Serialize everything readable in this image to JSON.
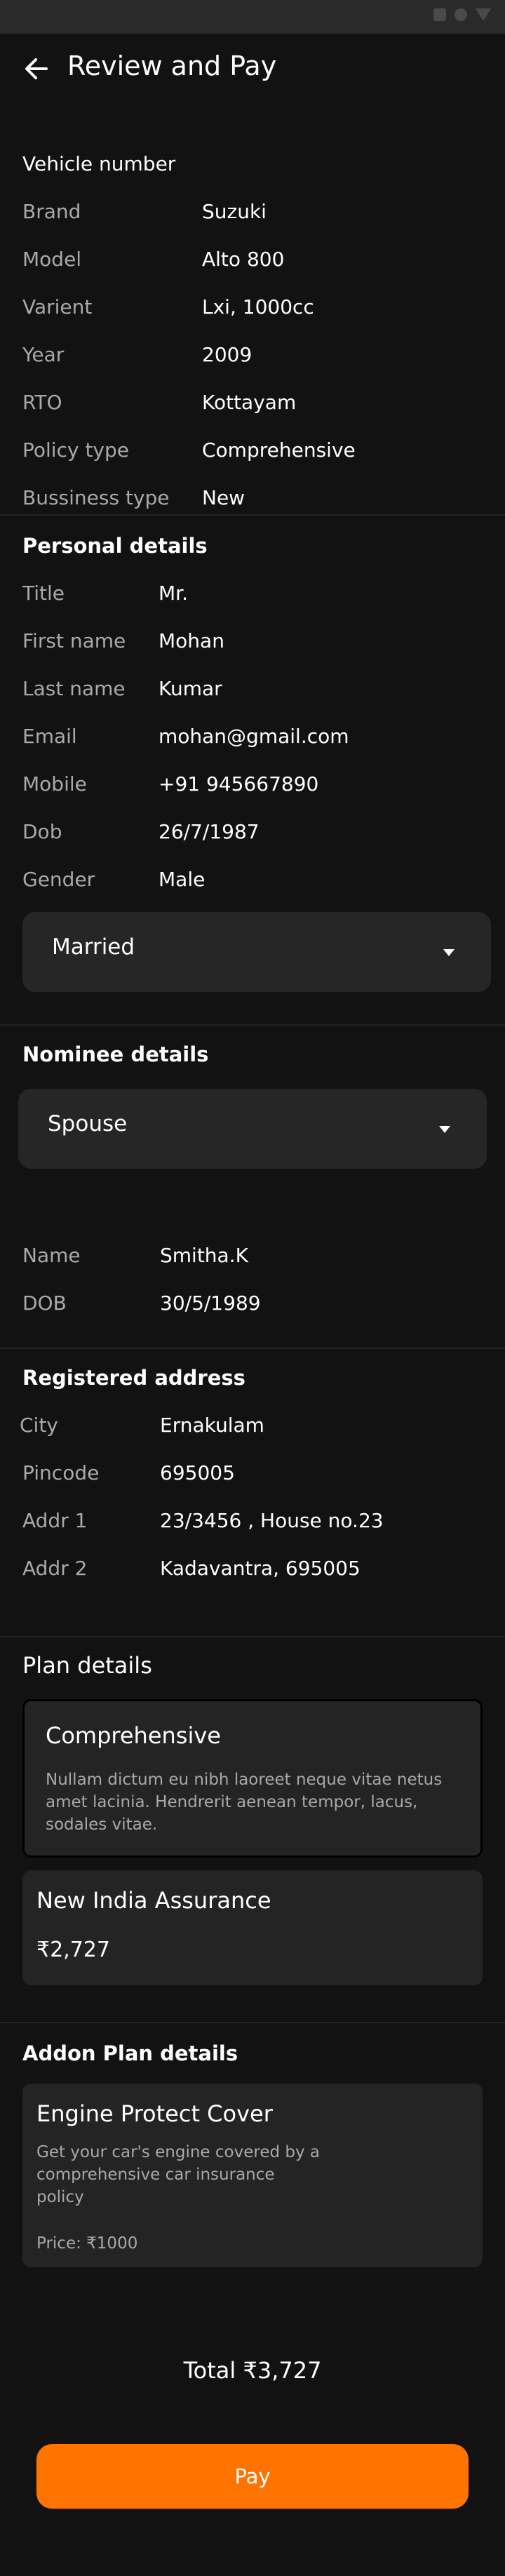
{
  "header": {
    "title": "Review and Pay"
  },
  "vehicle": {
    "section_title": "Vehicle number",
    "rows": [
      {
        "label": "Brand",
        "value": "Suzuki"
      },
      {
        "label": "Model",
        "value": "Alto 800"
      },
      {
        "label": "Varient",
        "value": "Lxi, 1000cc"
      },
      {
        "label": "Year",
        "value": "2009"
      },
      {
        "label": "RTO",
        "value": "Kottayam"
      },
      {
        "label": "Policy type",
        "value": "Comprehensive"
      },
      {
        "label": "Bussiness type",
        "value": "New"
      }
    ]
  },
  "personal": {
    "section_title": "Personal details",
    "rows": [
      {
        "label": "Title",
        "value": "Mr."
      },
      {
        "label": "First name",
        "value": "Mohan"
      },
      {
        "label": "Last name",
        "value": "Kumar"
      },
      {
        "label": "Email",
        "value": "mohan@gmail.com"
      },
      {
        "label": "Mobile",
        "value": "+91 945667890"
      },
      {
        "label": "Dob",
        "value": "26/7/1987"
      },
      {
        "label": "Gender",
        "value": "Male"
      }
    ],
    "marital_status": "Married"
  },
  "nominee": {
    "section_title": "Nominee details",
    "relation": "Spouse",
    "rows": [
      {
        "label": "Name",
        "value": "Smitha.K"
      },
      {
        "label": "DOB",
        "value": "30/5/1989"
      }
    ]
  },
  "address": {
    "section_title": "Registered address",
    "rows": [
      {
        "label": "City",
        "value": "Ernakulam"
      },
      {
        "label": "Pincode",
        "value": "695005"
      },
      {
        "label": "Addr 1",
        "value": "23/3456 , House no.23"
      },
      {
        "label": "Addr 2",
        "value": "Kadavantra, 695005"
      }
    ]
  },
  "plan": {
    "section_title": "Plan details",
    "cover": {
      "title": "Comprehensive",
      "desc_lines": [
        "Nullam dictum eu nibh laoreet neque vitae netus",
        "amet lacinia. Hendrerit aenean tempor, lacus,",
        "sodales vitae."
      ]
    },
    "insurer": {
      "name": "New India Assurance",
      "price": "₹2,727"
    }
  },
  "addon": {
    "section_title": "Addon Plan details",
    "title": "Engine Protect Cover",
    "desc_lines": [
      "Get your car's engine covered by a",
      "comprehensive car insurance",
      "policy"
    ],
    "price": "Price: ₹1000"
  },
  "total": "Total ₹3,727",
  "pay_label": "Pay",
  "colors": {
    "accent": "#ff7300",
    "background": "#121212",
    "card": "#242424"
  }
}
